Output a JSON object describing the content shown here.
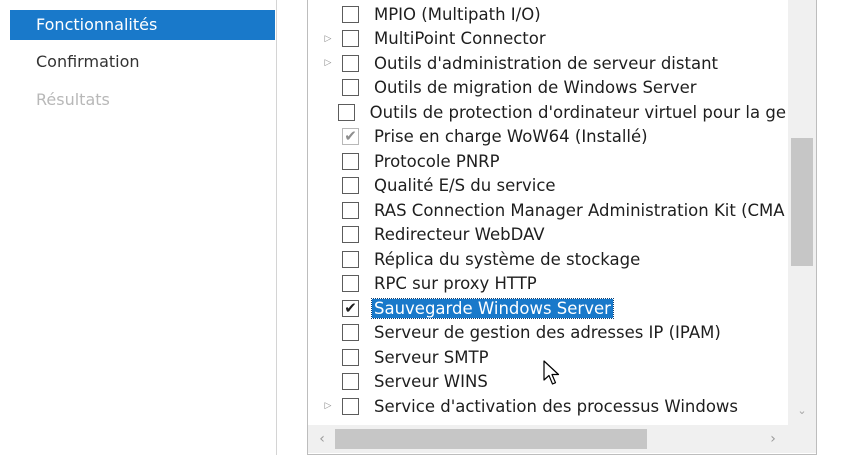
{
  "nav": {
    "items": [
      {
        "label": "Fonctionnalités",
        "state": "active"
      },
      {
        "label": "Confirmation",
        "state": "normal"
      },
      {
        "label": "Résultats",
        "state": "disabled"
      }
    ]
  },
  "features": [
    {
      "label": "MPIO (Multipath I/O)",
      "expandable": false,
      "checked": false
    },
    {
      "label": "MultiPoint Connector",
      "expandable": true,
      "checked": false
    },
    {
      "label": "Outils d'administration de serveur distant",
      "expandable": true,
      "checked": false
    },
    {
      "label": "Outils de migration de Windows Server",
      "expandable": false,
      "checked": false
    },
    {
      "label": "Outils de protection d'ordinateur virtuel pour la ge",
      "expandable": false,
      "checked": false
    },
    {
      "label": "Prise en charge WoW64 (Installé)",
      "expandable": false,
      "checked": true,
      "disabled": true
    },
    {
      "label": "Protocole PNRP",
      "expandable": false,
      "checked": false
    },
    {
      "label": "Qualité E/S du service",
      "expandable": false,
      "checked": false
    },
    {
      "label": "RAS Connection Manager Administration Kit (CMA",
      "expandable": false,
      "checked": false
    },
    {
      "label": "Redirecteur WebDAV",
      "expandable": false,
      "checked": false
    },
    {
      "label": "Réplica du système de stockage",
      "expandable": false,
      "checked": false
    },
    {
      "label": "RPC sur proxy HTTP",
      "expandable": false,
      "checked": false
    },
    {
      "label": "Sauvegarde Windows Server",
      "expandable": false,
      "checked": true,
      "selected": true
    },
    {
      "label": "Serveur de gestion des adresses IP (IPAM)",
      "expandable": false,
      "checked": false
    },
    {
      "label": "Serveur SMTP",
      "expandable": false,
      "checked": false
    },
    {
      "label": "Serveur WINS",
      "expandable": false,
      "checked": false
    },
    {
      "label": "Service d'activation des processus Windows",
      "expandable": true,
      "checked": false
    }
  ],
  "icons": {
    "expander": "chevron-right-icon",
    "check": "checkmark-icon",
    "scroll_down": "chevron-down-icon",
    "scroll_left": "chevron-left-icon",
    "scroll_right": "chevron-right-icon",
    "cursor": "mouse-pointer-icon"
  },
  "colors": {
    "accent": "#1979ca",
    "disabled_text": "#b8b8b8"
  }
}
